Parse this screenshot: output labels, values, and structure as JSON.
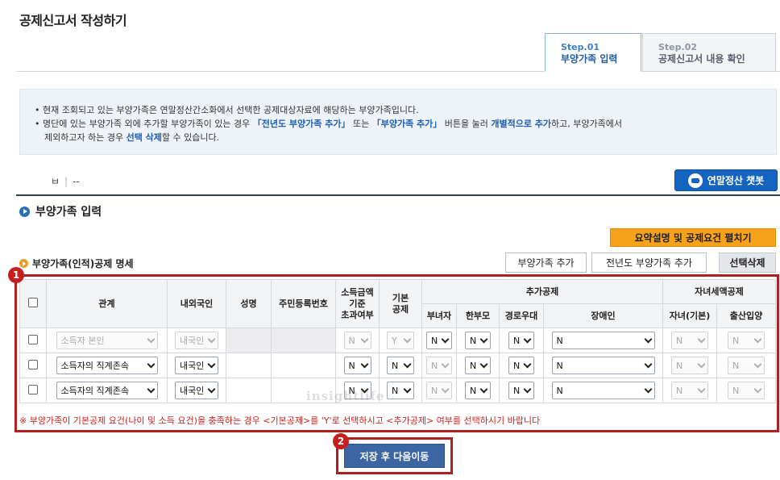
{
  "page_title": "공제신고서 작성하기",
  "steps": [
    {
      "no": "Step.01",
      "label": "부양가족 입력"
    },
    {
      "no": "Step.02",
      "label": "공제신고서 내용 확인"
    }
  ],
  "notice": {
    "line1": "• 현재 조회되고 있는 부양가족은 연말정산간소화에서 선택한 공제대상자료에 해당하는 부양가족입니다.",
    "line2_a": "• 명단에 있는 부양가족 외에 추가할 부양가족이 있는 경우 ",
    "line2_b": "「전년도 부양가족 추가」",
    "line2_c": " 또는 ",
    "line2_d": "「부양가족 추가」",
    "line2_e": " 버튼을 눌러 ",
    "line2_f": "개별적으로 추가",
    "line2_g": "하고, 부양가족에서",
    "line3_a": "제외하고자 하는 경우 ",
    "line3_b": "선택 삭제",
    "line3_c": "할 수 있습니다."
  },
  "nav": {
    "left": "ㅂ",
    "right": "--"
  },
  "chatbot_label": "연말정산 챗봇",
  "section_title": "부양가족 입력",
  "summary_button": "요약설명 및 공제요건 펼치기",
  "sub_title": "부양가족(인적)공제 명세",
  "buttons": {
    "add": "부양가족 추가",
    "add_prev": "전년도 부양가족 추가",
    "delete": "선택삭제"
  },
  "badges": {
    "one": "1",
    "two": "2"
  },
  "table": {
    "headers": {
      "relation": "관계",
      "nationality": "내외국인",
      "name": "성명",
      "rrn": "주민등록번호",
      "income_l1": "소득금액",
      "income_l2": "기준",
      "income_l3": "초과여부",
      "basic_l1": "기본",
      "basic_l2": "공제",
      "additional": "추가공제",
      "child_tax": "자녀세액공제",
      "female": "부녀자",
      "single_parent": "한부모",
      "elderly": "경로우대",
      "disabled": "장애인",
      "child_basic": "자녀(기본)",
      "birth": "출산입양"
    },
    "rows": [
      {
        "relation": "소득자 본인",
        "nationality": "내국인",
        "income": "N",
        "basic": "Y",
        "female": "N",
        "single_parent": "N",
        "elderly": "N",
        "disabled": "N",
        "child_basic": "N",
        "birth": "N"
      },
      {
        "relation": "소득자의 직계존속",
        "nationality": "내국인",
        "income": "N",
        "basic": "N",
        "female": "N",
        "single_parent": "N",
        "elderly": "N",
        "disabled": "N",
        "child_basic": "N",
        "birth": "N"
      },
      {
        "relation": "소득자의 직계존속",
        "nationality": "내국인",
        "income": "N",
        "basic": "N",
        "female": "N",
        "single_parent": "N",
        "elderly": "N",
        "disabled": "N",
        "child_basic": "N",
        "birth": "N"
      }
    ]
  },
  "footnote": "※ 부양가족이 기본공제 요건(나이 및 소득 요건)을 충족하는 경우 <기본공제>를 'Y'로 선택하시고 <추가공제> 여부를 선택하시기 바랍니다",
  "save_button": "저장 후 다음이동",
  "watermark": "insightlife",
  "colors": {
    "accent": "#1565c0",
    "warning": "#f7a21b",
    "highlight": "#b11f1f",
    "save": "#3c65a3"
  }
}
